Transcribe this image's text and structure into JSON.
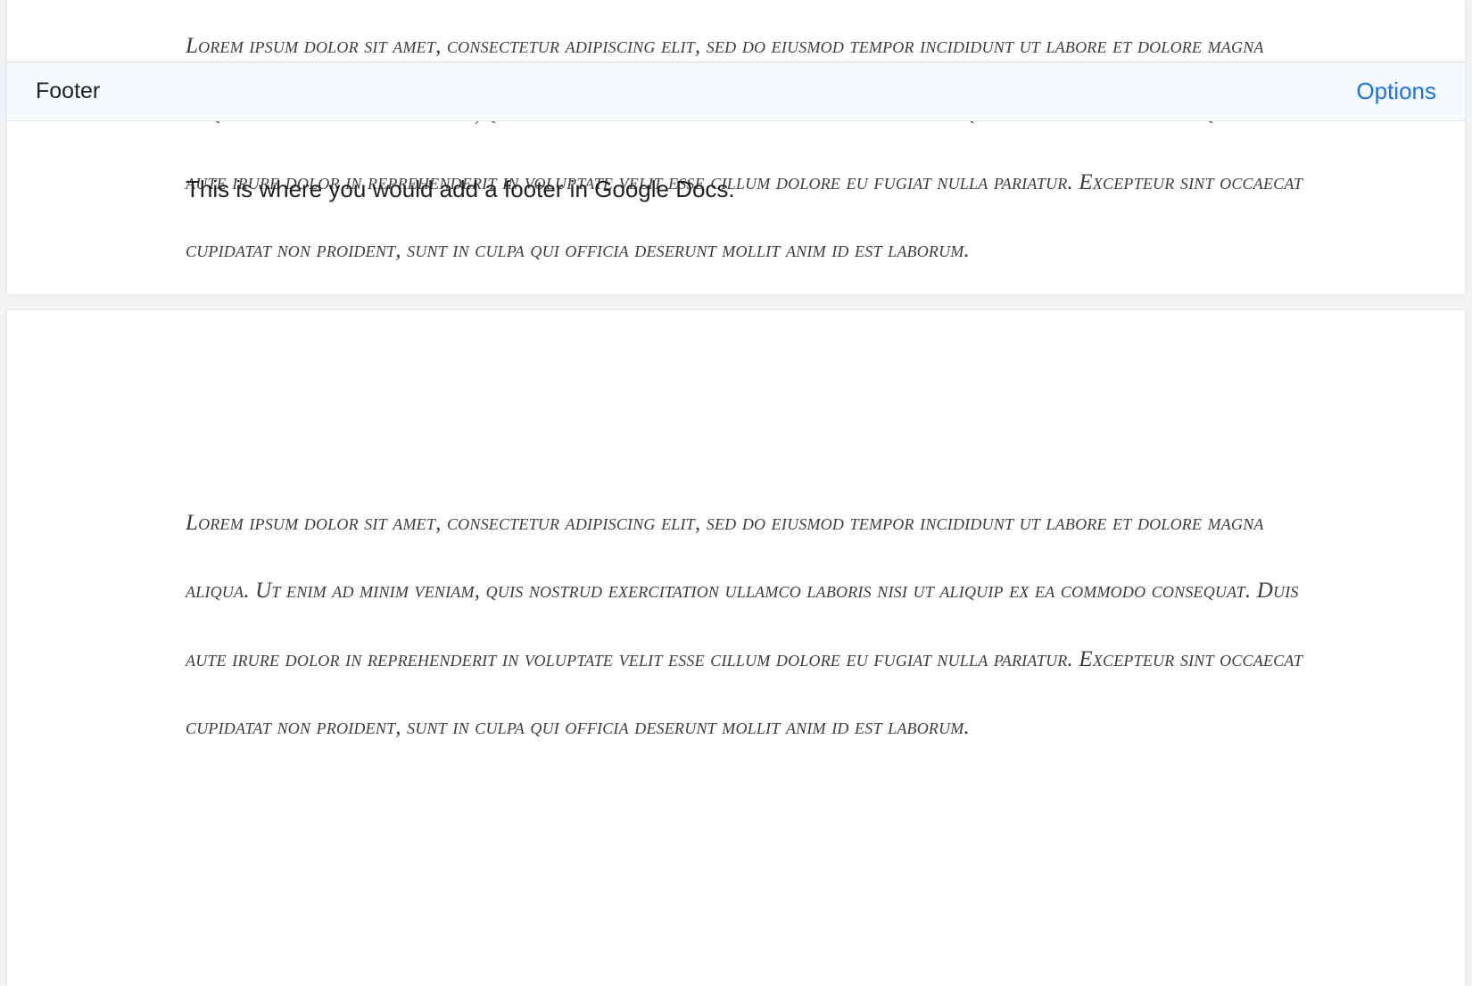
{
  "page1": {
    "body_text": "Lorem ipsum dolor sit amet, consectetur adipiscing elit, sed do eiusmod tempor incididunt ut labore et dolore magna aliqua. Ut enim ad minim veniam, quis nostrud exercitation ullamco laboris nisi ut aliquip ex ea commodo consequat. Duis aute irure dolor in reprehenderit in voluptate velit esse cillum dolore eu fugiat nulla pariatur. Excepteur sint occaecat cupidatat non proident, sunt in culpa qui officia deserunt mollit anim id est laborum."
  },
  "footer": {
    "label": "Footer",
    "options_label": "Options",
    "content": "This is where you would add a footer in Google Docs."
  },
  "page2": {
    "body_text": "Lorem ipsum dolor sit amet, consectetur adipiscing elit, sed do eiusmod tempor incididunt ut labore et dolore magna aliqua. Ut enim ad minim veniam, quis nostrud exercitation ullamco laboris nisi ut aliquip ex ea commodo consequat. Duis aute irure dolor in reprehenderit in voluptate velit esse cillum dolore eu fugiat nulla pariatur. Excepteur sint occaecat cupidatat non proident, sunt in culpa qui officia deserunt mollit anim id est laborum."
  }
}
